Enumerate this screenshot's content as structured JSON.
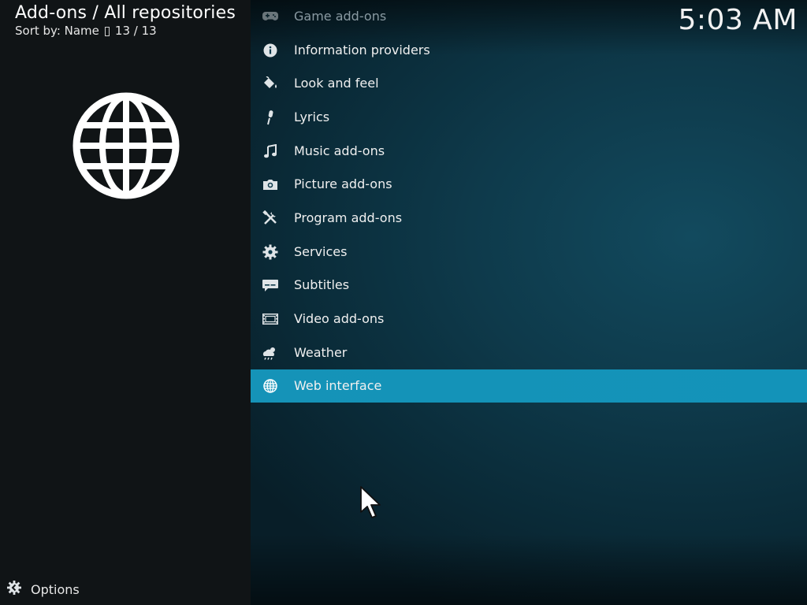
{
  "header": {
    "title": "Add-ons / All repositories",
    "sort_label": "Sort by: Name",
    "count": "13 / 13"
  },
  "clock": "5:03 AM",
  "thumbnail": {
    "icon": "globe-icon"
  },
  "list": {
    "items": [
      {
        "label": "Game add-ons",
        "icon": "gamepad-icon"
      },
      {
        "label": "Information providers",
        "icon": "info-icon"
      },
      {
        "label": "Look and feel",
        "icon": "paint-bucket-icon"
      },
      {
        "label": "Lyrics",
        "icon": "microphone-icon"
      },
      {
        "label": "Music add-ons",
        "icon": "music-note-icon"
      },
      {
        "label": "Picture add-ons",
        "icon": "camera-icon"
      },
      {
        "label": "Program add-ons",
        "icon": "tools-icon"
      },
      {
        "label": "Services",
        "icon": "gear-icon"
      },
      {
        "label": "Subtitles",
        "icon": "subtitles-icon"
      },
      {
        "label": "Video add-ons",
        "icon": "film-icon"
      },
      {
        "label": "Weather",
        "icon": "weather-icon"
      },
      {
        "label": "Web interface",
        "icon": "globe-icon",
        "selected": true
      }
    ]
  },
  "footer": {
    "options_label": "Options",
    "icon": "options-gear-icon"
  },
  "colors": {
    "accent": "#1593b8",
    "left_panel": "#101416",
    "background": "#0e3a4b"
  }
}
